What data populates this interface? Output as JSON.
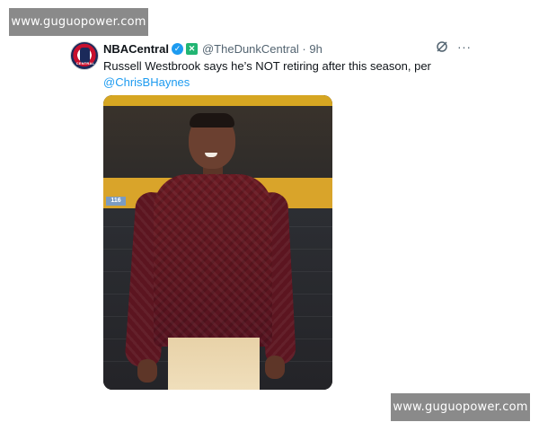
{
  "watermarks": {
    "top": "www.guguopower.com",
    "bottom": "www.guguopower.com"
  },
  "tweet": {
    "avatar_text": "CENTRAL",
    "display_name": "NBACentral",
    "verified_icon": "verified-badge-icon",
    "affiliate_icon": "affiliate-badge-icon",
    "affiliate_glyph": "✕",
    "handle_time": "@TheDunkCentral · 9h",
    "text": "Russell Westbrook says he’s NOT retiring after this season, per",
    "mention": "@ChrisBHaynes",
    "more": "···",
    "media": {
      "seat_label": "116"
    }
  },
  "colors": {
    "link": "#1d9bf0",
    "verified": "#1d9bf0",
    "affiliate": "#22b573",
    "watermark_bg": "#8a8a8a"
  }
}
